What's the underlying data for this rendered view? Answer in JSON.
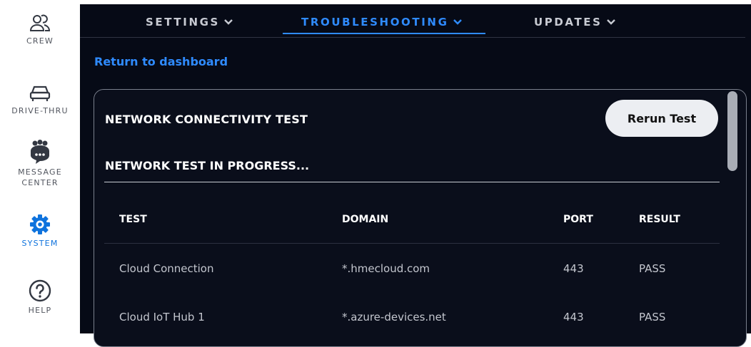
{
  "sidebar": {
    "items": [
      {
        "label": "CREW",
        "icon": "users-icon"
      },
      {
        "label": "DRIVE-THRU",
        "icon": "car-icon"
      },
      {
        "label_line1": "MESSAGE",
        "label_line2": "CENTER",
        "icon": "message-center-icon"
      },
      {
        "label": "SYSTEM",
        "icon": "gear-icon",
        "active": true
      },
      {
        "label": "HELP",
        "icon": "help-icon"
      }
    ],
    "active_color": "#0f73dd"
  },
  "tabs": [
    {
      "label": "SETTINGS"
    },
    {
      "label": "TROUBLESHOOTING",
      "active": true
    },
    {
      "label": "UPDATES"
    }
  ],
  "return_link": "Return to dashboard",
  "card": {
    "title": "NETWORK CONNECTIVITY TEST",
    "rerun_label": "Rerun Test",
    "progress_text": "NETWORK TEST IN PROGRESS...",
    "table": {
      "headers": [
        "TEST",
        "DOMAIN",
        "PORT",
        "RESULT"
      ],
      "rows": [
        [
          "Cloud Connection",
          "*.hmecloud.com",
          "443",
          "PASS"
        ],
        [
          "Cloud IoT Hub 1",
          "*.azure-devices.net",
          "443",
          "PASS"
        ]
      ]
    }
  },
  "colors": {
    "background": "#060a16",
    "accent": "#2f8bff"
  }
}
